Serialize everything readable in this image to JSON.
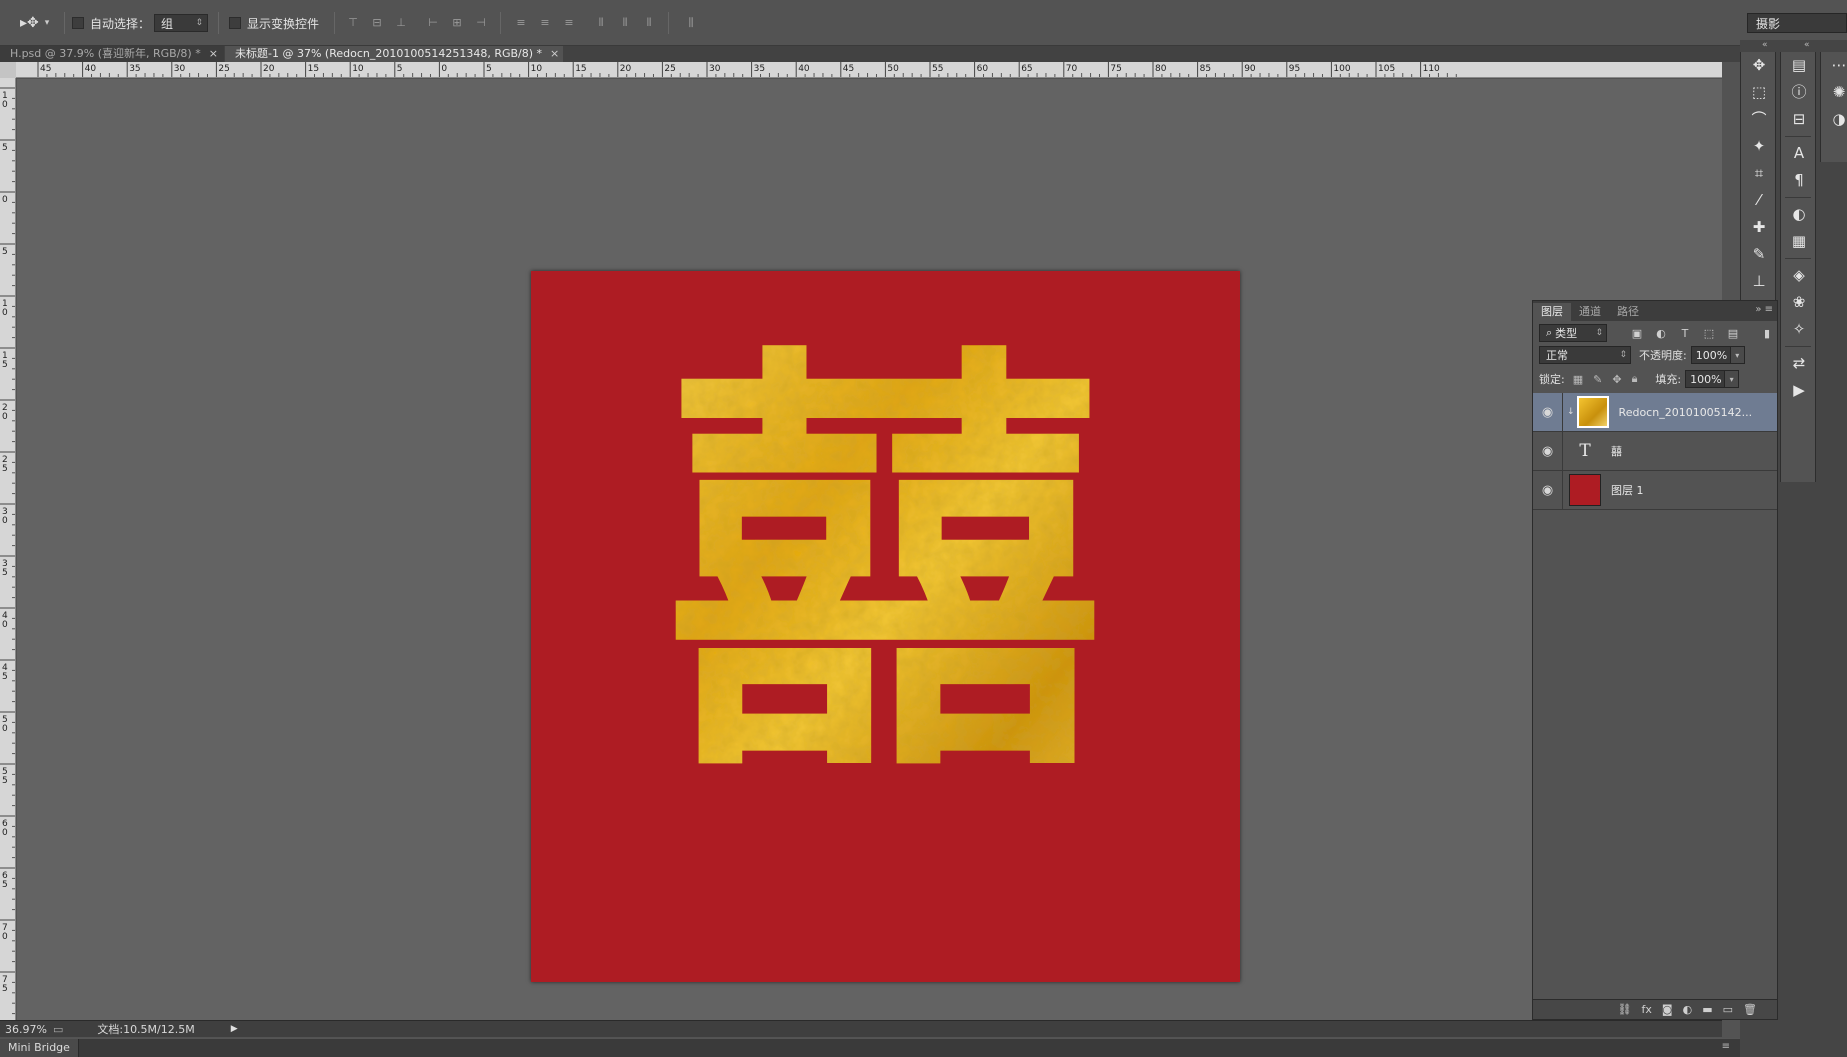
{
  "optbar": {
    "tool_icon": "move-tool-icon",
    "auto_select_label": "自动选择：",
    "auto_select_value": "组",
    "show_transform_label": "显示变换控件",
    "workspace": "摄影"
  },
  "tabs": [
    {
      "label": "H.psd @ 37.9% (喜迎新年, RGB/8) *",
      "close": "×"
    },
    {
      "label": "未标题-1 @ 37% (Redocn_2010100514251348, RGB/8) *",
      "close": "×"
    }
  ],
  "ruler_top_labels": [
    "45",
    "40",
    "35",
    "30",
    "25",
    "20",
    "15",
    "10",
    "5",
    "0",
    "5",
    "10",
    "15",
    "20",
    "25",
    "30",
    "35",
    "40",
    "45",
    "50",
    "55",
    "60",
    "65",
    "70",
    "75",
    "80",
    "85",
    "90",
    "95",
    "100",
    "105",
    "110"
  ],
  "ruler_left_labels": [
    "10",
    "5",
    "0",
    "5",
    "10",
    "15",
    "20",
    "25",
    "30",
    "35",
    "40",
    "45",
    "50",
    "55",
    "60",
    "65",
    "70",
    "75"
  ],
  "canvas": {
    "background": "#ae1c23",
    "artwork_text": "囍",
    "gold": "#f0b81c"
  },
  "status": {
    "zoom": "36.97%",
    "doc": "文档:10.5M/12.5M"
  },
  "mini_bridge": "Mini Bridge",
  "layers_panel": {
    "tabs": [
      "图层",
      "通道",
      "路径"
    ],
    "filter_kind": "类型",
    "blend_mode": "正常",
    "opacity_label": "不透明度:",
    "opacity_value": "100%",
    "lock_label": "锁定:",
    "fill_label": "填充:",
    "fill_value": "100%",
    "layers": [
      {
        "name": "Redocn_20101005142...",
        "type": "image",
        "selected": true
      },
      {
        "name": "囍",
        "type": "text",
        "selected": false
      },
      {
        "name": "图层 1",
        "type": "fill",
        "selected": false
      }
    ]
  }
}
